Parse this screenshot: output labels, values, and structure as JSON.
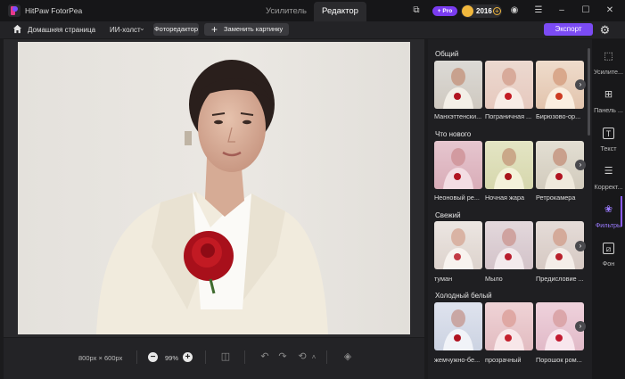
{
  "window": {
    "app_title": "HitPaw FotorPea",
    "tabs": [
      "Усилитель",
      "Редактор"
    ],
    "pro_badge": "+ Pro",
    "coins": "2016"
  },
  "toolbar": {
    "home_label": "Домашняя страница",
    "ai_canvas_label": "ИИ-холст",
    "photo_editor_label": "Фоторедактор",
    "replace_label": "Заменить картинку",
    "export_label": "Экспорт"
  },
  "bottom": {
    "size_label": "800px × 600px",
    "zoom_label": "99%"
  },
  "filters": {
    "sections": [
      {
        "title": "Общий",
        "items": [
          "Манхэттенски...",
          "Пограничная ...",
          "Бирюзово-ор..."
        ]
      },
      {
        "title": "Что нового",
        "items": [
          "Неоновый ре...",
          "Ночная жара",
          "Ретрокамера"
        ]
      },
      {
        "title": "Свежий",
        "items": [
          "туман",
          "Мыло",
          "Предисловие ..."
        ]
      },
      {
        "title": "Холодный белый",
        "items": [
          "жемчужно-бе...",
          "прозрачный",
          "Порошок ром..."
        ]
      }
    ]
  },
  "side_nav": {
    "items": [
      {
        "label": "Усилите...",
        "icon": "enhance-icon"
      },
      {
        "label": "Панель ...",
        "icon": "panel-icon"
      },
      {
        "label": "Текст",
        "icon": "text-icon"
      },
      {
        "label": "Коррект...",
        "icon": "adjust-icon"
      },
      {
        "label": "Фильтры",
        "icon": "filters-icon"
      },
      {
        "label": "Фон",
        "icon": "background-icon"
      }
    ],
    "active_index": 4
  },
  "colors": {
    "accent": "#7b4bf4",
    "active_nav": "#9b7bff",
    "coin": "#f0b73d"
  }
}
